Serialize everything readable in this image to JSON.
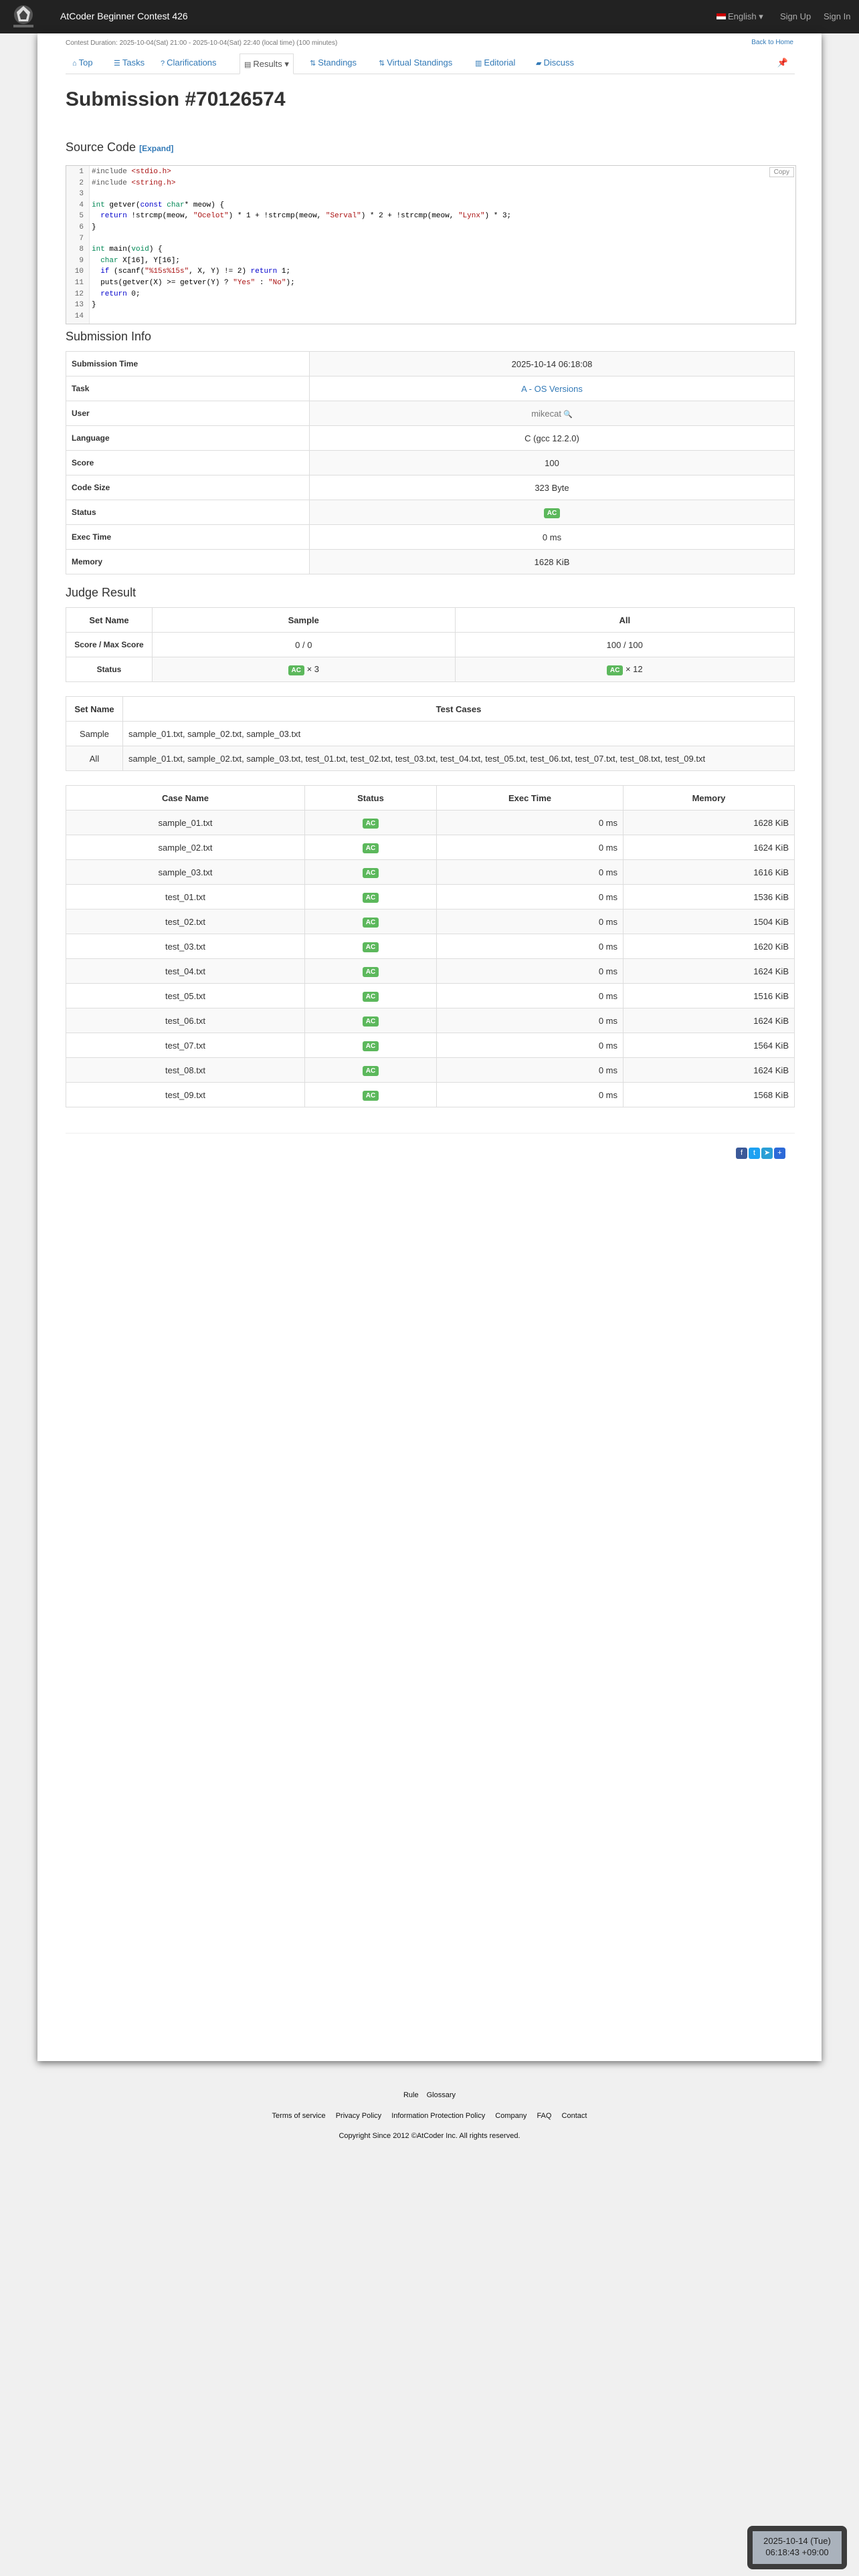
{
  "nav": {
    "brand": "AtCoder Beginner Contest 426",
    "language": "English",
    "signup": "Sign Up",
    "signin": "Sign In"
  },
  "contest": {
    "duration": "Contest Duration: 2025-10-04(Sat) 21:00 - 2025-10-04(Sat) 22:40 (local time) (100 minutes)",
    "back": "Back to Home"
  },
  "tabs": [
    "Top",
    "Tasks",
    "Clarifications",
    "Results",
    "Standings",
    "Virtual Standings",
    "Editorial",
    "Discuss"
  ],
  "title": "Submission #70126574",
  "source": {
    "heading": "Source Code",
    "expand": "[Expand]",
    "copy": "Copy",
    "lines": [
      "#include <stdio.h>",
      "#include <string.h>",
      "",
      "int getver(const char* meow) {",
      "  return !strcmp(meow, \"Ocelot\") * 1 + !strcmp(meow, \"Serval\") * 2 + !strcmp(meow, \"Lynx\") * 3;",
      "}",
      "",
      "int main(void) {",
      "  char X[16], Y[16];",
      "  if (scanf(\"%15s%15s\", X, Y) != 2) return 1;",
      "  puts(getver(X) >= getver(Y) ? \"Yes\" : \"No\");",
      "  return 0;",
      "}",
      ""
    ]
  },
  "info": {
    "heading": "Submission Info",
    "rows": [
      {
        "k": "Submission Time",
        "v": "2025-10-14 06:18:08"
      },
      {
        "k": "Task",
        "v": "A - OS Versions"
      },
      {
        "k": "User",
        "v": "mikecat"
      },
      {
        "k": "Language",
        "v": "C (gcc 12.2.0)"
      },
      {
        "k": "Score",
        "v": "100"
      },
      {
        "k": "Code Size",
        "v": "323 Byte"
      },
      {
        "k": "Status",
        "v": "AC"
      },
      {
        "k": "Exec Time",
        "v": "0 ms"
      },
      {
        "k": "Memory",
        "v": "1628 KiB"
      }
    ]
  },
  "judge": {
    "heading": "Judge Result",
    "h_set": "Set Name",
    "h_sample": "Sample",
    "h_all": "All",
    "r1": "Score / Max Score",
    "s1": "0 / 0",
    "a1": "100 / 100",
    "r2": "Status",
    "s2": "AC",
    "s2x": "× 3",
    "a2": "AC",
    "a2x": "× 12"
  },
  "sets": {
    "h_set": "Set Name",
    "h_cases": "Test Cases",
    "rows": [
      {
        "name": "Sample",
        "cases": "sample_01.txt, sample_02.txt, sample_03.txt"
      },
      {
        "name": "All",
        "cases": "sample_01.txt, sample_02.txt, sample_03.txt, test_01.txt, test_02.txt, test_03.txt, test_04.txt, test_05.txt, test_06.txt, test_07.txt, test_08.txt, test_09.txt"
      }
    ]
  },
  "cases": {
    "headers": [
      "Case Name",
      "Status",
      "Exec Time",
      "Memory"
    ],
    "rows": [
      [
        "sample_01.txt",
        "AC",
        "0 ms",
        "1628 KiB"
      ],
      [
        "sample_02.txt",
        "AC",
        "0 ms",
        "1624 KiB"
      ],
      [
        "sample_03.txt",
        "AC",
        "0 ms",
        "1616 KiB"
      ],
      [
        "test_01.txt",
        "AC",
        "0 ms",
        "1536 KiB"
      ],
      [
        "test_02.txt",
        "AC",
        "0 ms",
        "1504 KiB"
      ],
      [
        "test_03.txt",
        "AC",
        "0 ms",
        "1620 KiB"
      ],
      [
        "test_04.txt",
        "AC",
        "0 ms",
        "1624 KiB"
      ],
      [
        "test_05.txt",
        "AC",
        "0 ms",
        "1516 KiB"
      ],
      [
        "test_06.txt",
        "AC",
        "0 ms",
        "1624 KiB"
      ],
      [
        "test_07.txt",
        "AC",
        "0 ms",
        "1564 KiB"
      ],
      [
        "test_08.txt",
        "AC",
        "0 ms",
        "1624 KiB"
      ],
      [
        "test_09.txt",
        "AC",
        "0 ms",
        "1568 KiB"
      ]
    ]
  },
  "footer": {
    "rule": "Rule",
    "glossary": "Glossary",
    "links": [
      "Terms of service",
      "Privacy Policy",
      "Information Protection Policy",
      "Company",
      "FAQ",
      "Contact"
    ],
    "copyright": "Copyright Since 2012 ©AtCoder Inc. All rights reserved."
  },
  "clock": {
    "date": "2025-10-14 (Tue)",
    "time": "06:18:43 +09:00"
  },
  "colors": {
    "navbar": "#222222",
    "link": "#337ab7",
    "ac": "#5cb85c"
  }
}
